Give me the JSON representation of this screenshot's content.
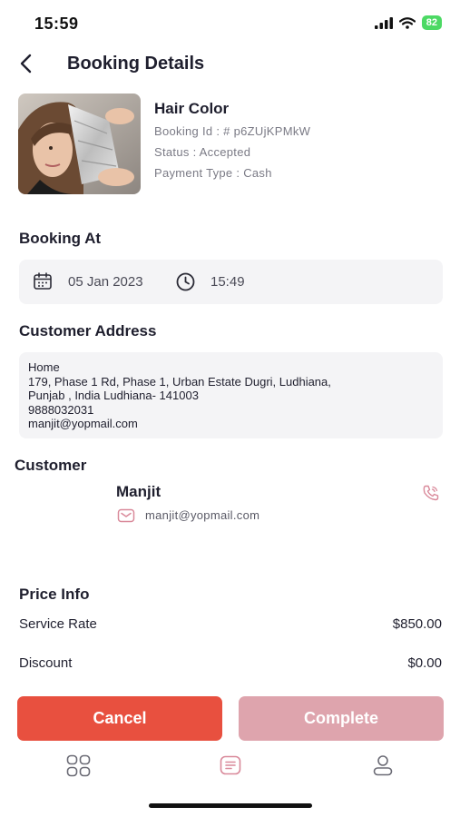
{
  "status_bar": {
    "time": "15:59",
    "battery": "82"
  },
  "header": {
    "title": "Booking Details"
  },
  "service": {
    "name": "Hair Color",
    "booking_id": "Booking Id : # p6ZUjKPMkW",
    "status": "Status : Accepted",
    "payment_type": "Payment Type : Cash"
  },
  "booking_at": {
    "title": "Booking At",
    "date": "05 Jan 2023",
    "time": "15:49"
  },
  "address": {
    "title": "Customer Address",
    "lines": [
      "Home",
      "179, Phase 1 Rd, Phase 1, Urban Estate Dugri, Ludhiana,",
      "Punjab , India Ludhiana- 141003",
      "9888032031",
      "manjit@yopmail.com"
    ]
  },
  "customer": {
    "title": "Customer",
    "name": "Manjit",
    "email": "manjit@yopmail.com"
  },
  "price_info": {
    "title": "Price Info",
    "rows": [
      {
        "label": "Service Rate",
        "value": "$850.00"
      },
      {
        "label": "Discount",
        "value": "$0.00"
      }
    ]
  },
  "actions": {
    "cancel": "Cancel",
    "complete": "Complete"
  },
  "tabs": [
    {
      "icon": "grid-icon",
      "active": false
    },
    {
      "icon": "bookings-icon",
      "active": true
    },
    {
      "icon": "profile-icon",
      "active": false
    }
  ],
  "colors": {
    "accent": "#e8503f",
    "complete_button": "#dea4ad",
    "icon_pink": "#d9899a",
    "box_bg": "#f4f4f6"
  }
}
